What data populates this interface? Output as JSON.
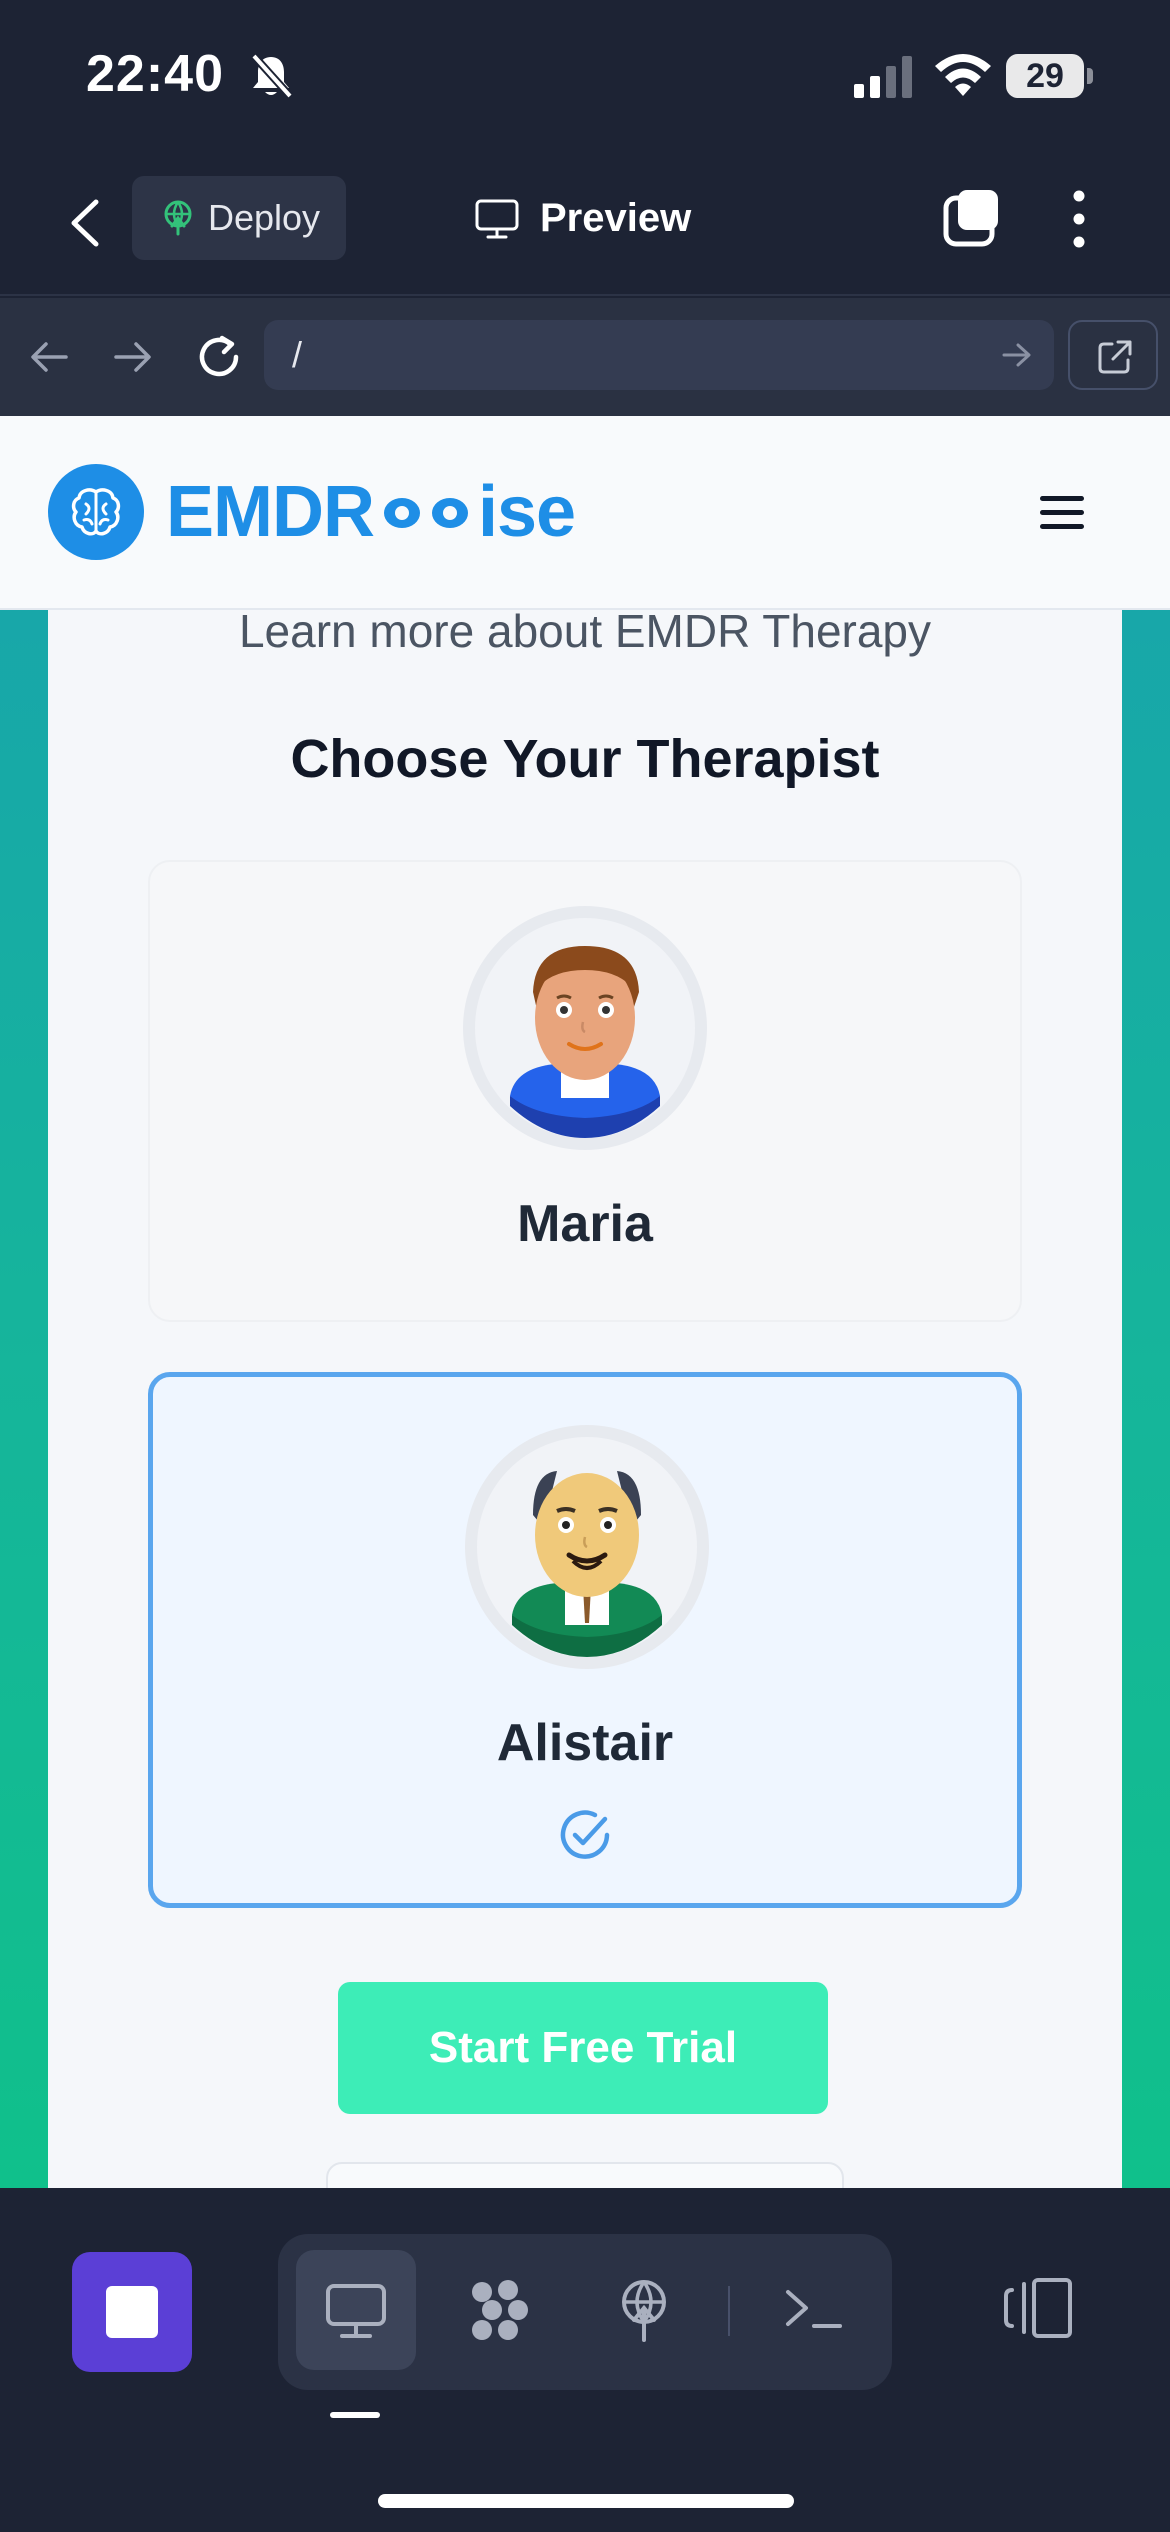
{
  "status_bar": {
    "time": "22:40",
    "battery": "29",
    "icons": [
      "bell-slash-icon",
      "signal-icon",
      "wifi-icon",
      "battery-icon"
    ]
  },
  "toolbar": {
    "deploy_label": "Deploy",
    "preview_label": "Preview"
  },
  "browser": {
    "url": "/"
  },
  "site": {
    "logo_left": "EMDR",
    "logo_right": "ise",
    "learn_more": "Learn more about EMDR Therapy",
    "section_title": "Choose Your Therapist",
    "therapists": [
      {
        "name": "Maria",
        "selected": false
      },
      {
        "name": "Alistair",
        "selected": true
      }
    ],
    "trial_button": "Start Free Trial"
  },
  "colors": {
    "brand": "#1e8ee6",
    "selected_border": "#5aa6ee",
    "trial_button": "#3dedb7",
    "stop_button": "#5b3fd6",
    "app_background": "#1d2334"
  }
}
